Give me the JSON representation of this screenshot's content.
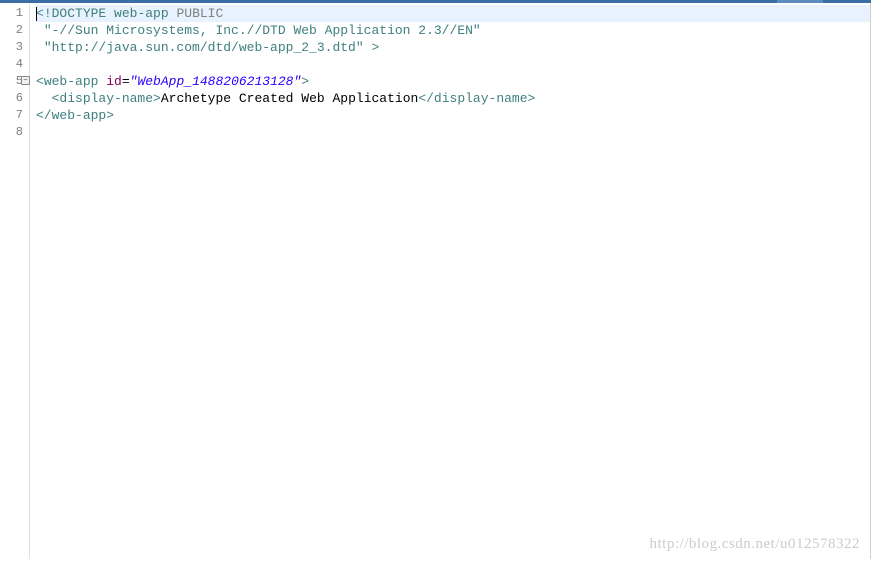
{
  "gutter": {
    "lines": [
      "1",
      "2",
      "3",
      "4",
      "5",
      "6",
      "7",
      "8"
    ]
  },
  "code": {
    "line1": {
      "open": "<",
      "bang": "!",
      "doctype": "DOCTYPE",
      "space1": " ",
      "webapp": "web-app",
      "space2": " ",
      "public": "PUBLIC"
    },
    "line2": {
      "indent": " ",
      "text": "\"-//Sun Microsystems, Inc.//DTD Web Application 2.3//EN\""
    },
    "line3": {
      "indent": " ",
      "url": "\"http://java.sun.com/dtd/web-app_2_3.dtd\"",
      "space": " ",
      "close": ">"
    },
    "line5": {
      "open": "<",
      "tag": "web-app",
      "space": " ",
      "attr": "id",
      "eq": "=",
      "value": "\"WebApp_1488206213128\"",
      "close": ">"
    },
    "line6": {
      "indent": "  ",
      "open1": "<",
      "tag1": "display-name",
      "close1": ">",
      "content": "Archetype Created Web Application",
      "open2": "</",
      "tag2": "display-name",
      "close2": ">"
    },
    "line7": {
      "open": "</",
      "tag": "web-app",
      "close": ">"
    }
  },
  "fold_marker": "−",
  "watermark": "http://blog.csdn.net/u012578322"
}
